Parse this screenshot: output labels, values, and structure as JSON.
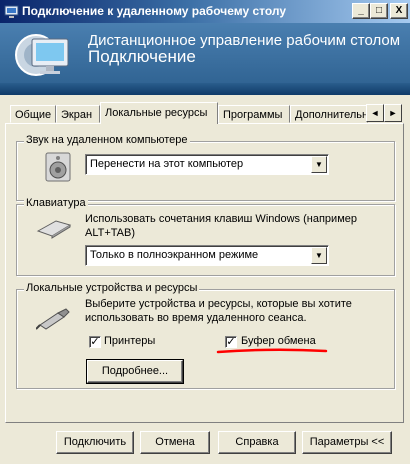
{
  "window": {
    "title": "Подключение к удаленному рабочему столу",
    "minimize": "_",
    "maximize": "□",
    "close": "X"
  },
  "banner": {
    "line1": "Дистанционное управление рабочим столом",
    "line2": "Подключение"
  },
  "tabs": [
    {
      "label": "Общие",
      "active": false
    },
    {
      "label": "Экран",
      "active": false
    },
    {
      "label": "Локальные ресурсы",
      "active": true
    },
    {
      "label": "Программы",
      "active": false
    },
    {
      "label": "Дополнительн",
      "active": false
    }
  ],
  "tab_scroll": {
    "left": "◄",
    "right": "►"
  },
  "sound": {
    "group_label": "Звук на удаленном компьютере",
    "selected": "Перенести на этот компьютер",
    "arrow": "▼"
  },
  "keyboard": {
    "group_label": "Клавиатура",
    "description": "Использовать сочетания клавиш Windows (например ALT+TAB)",
    "selected": "Только в полноэкранном режиме",
    "arrow": "▼"
  },
  "devices": {
    "group_label": "Локальные устройства и ресурсы",
    "description": "Выберите устройства и ресурсы, которые вы хотите использовать во время удаленного сеанса.",
    "printers_label": "Принтеры",
    "printers_checked": true,
    "clipboard_label": "Буфер обмена",
    "clipboard_checked": true,
    "details_button": "Подробнее...",
    "check_mark": "✓"
  },
  "buttons": {
    "connect": "Подключить",
    "cancel": "Отмена",
    "help": "Справка",
    "options": "Параметры <<"
  },
  "colors": {
    "title_bar": "#0a246a",
    "banner": "#2c5f8e",
    "dialog_bg": "#ece9d8",
    "annotation_underline": "#ff0000"
  }
}
